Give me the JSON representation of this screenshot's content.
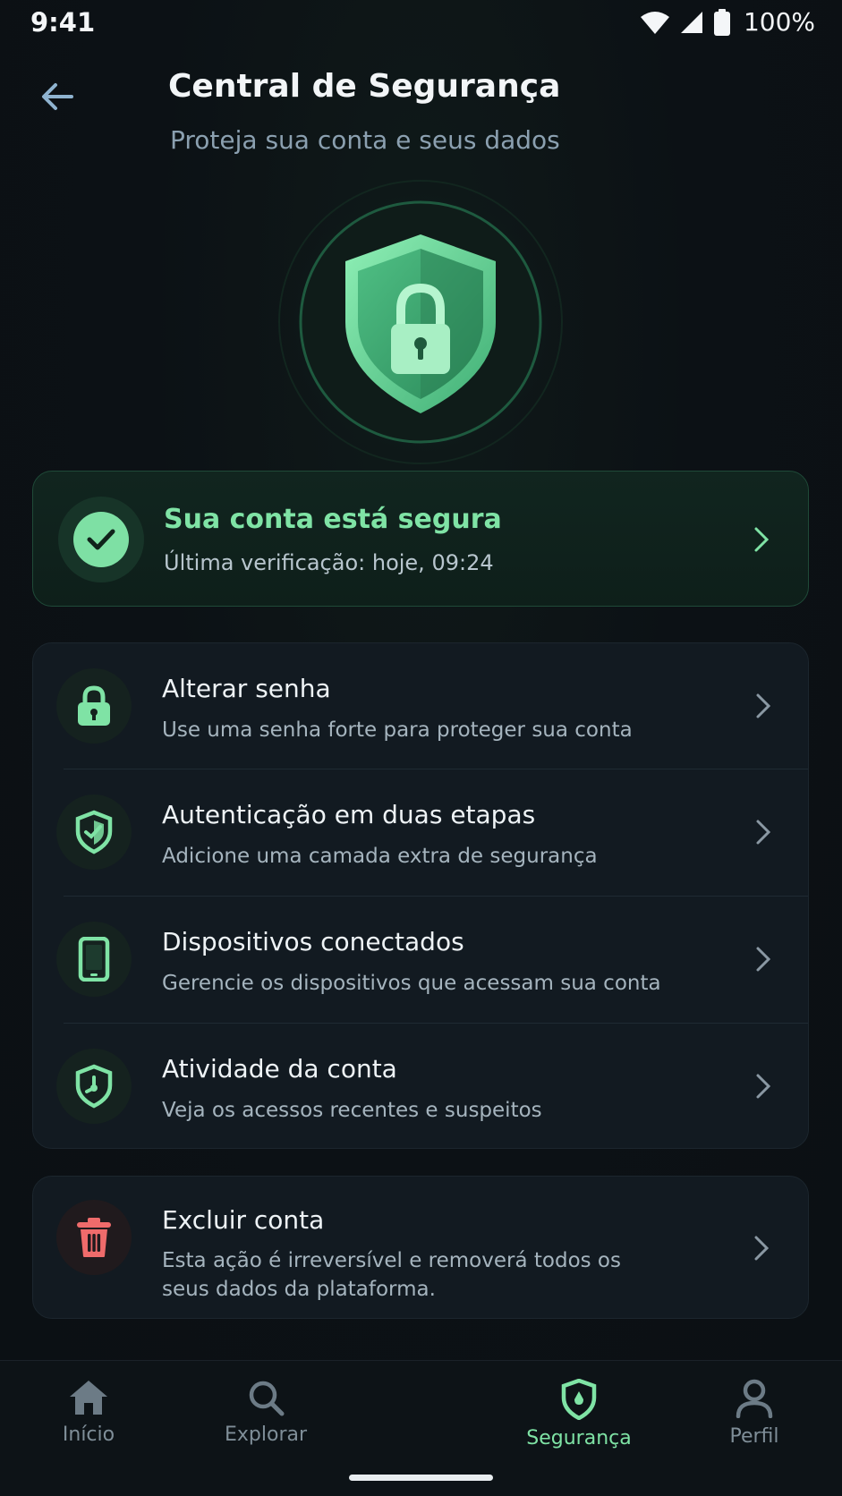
{
  "status_bar": {
    "time": "9:41",
    "battery": "100%",
    "icons": [
      "wifi-icon",
      "signal-icon",
      "battery-icon"
    ]
  },
  "header": {
    "title": "Central de Segurança",
    "subtitle": "Proteja sua conta e seus dados",
    "back_icon": "arrow-left-icon"
  },
  "hero": {
    "icon": "shield-lock-icon"
  },
  "status_card": {
    "title": "Sua conta está segura",
    "subtitle": "Última verificação: hoje, 09:24",
    "icon": "check-circle-icon"
  },
  "settings": [
    {
      "title": "Alterar senha",
      "description": "Use uma senha forte para proteger sua conta",
      "icon": "lock-icon"
    },
    {
      "title": "Autenticação em duas etapas",
      "description": "Adicione uma camada extra de segurança",
      "icon": "shield-check-icon"
    },
    {
      "title": "Dispositivos conectados",
      "description": "Gerencie os dispositivos que acessam sua conta",
      "icon": "smartphone-icon"
    },
    {
      "title": "Atividade da conta",
      "description": "Veja os acessos recentes e suspeitos",
      "icon": "shield-clock-icon"
    }
  ],
  "delete_account": {
    "title": "Excluir conta",
    "description": "Esta ação é irreversível e removerá todos os seus dados da plataforma.",
    "icon": "trash-icon"
  },
  "bottom_nav": [
    {
      "label": "Início",
      "icon": "home-icon",
      "active": false
    },
    {
      "label": "Explorar",
      "icon": "search-icon",
      "active": false
    },
    {
      "label": "Segurança",
      "icon": "shield-icon",
      "active": true
    },
    {
      "label": "Perfil",
      "icon": "user-icon",
      "active": false
    }
  ],
  "colors": {
    "background": "#0c1115",
    "accent": "#7fe3a5",
    "danger": "#ef6b6b",
    "muted": "#a5b4be"
  }
}
